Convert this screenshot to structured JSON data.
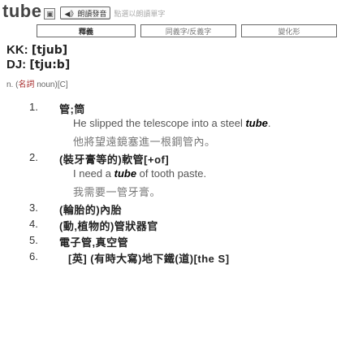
{
  "header": {
    "word": "tube",
    "copy_icon": "▣",
    "speak_button": "◀》朗讀發音",
    "speak_icon": "speaker-icon",
    "note": "點選以朗讀單字"
  },
  "tabs": [
    {
      "label": "釋義",
      "active": true
    },
    {
      "label": "同義字/反義字",
      "active": false
    },
    {
      "label": "變化形",
      "active": false
    }
  ],
  "pronunciation": {
    "kk_label": "KK:",
    "kk_value": "[tjub]",
    "dj_label": "DJ:",
    "dj_value": "[tju:b]"
  },
  "part_of_speech": {
    "abbr": "n.",
    "detail_open": "(",
    "detail_label": "名詞",
    "detail_rest": " noun)[C]"
  },
  "senses": [
    {
      "num": "1.",
      "def": "管;筒",
      "example_pre": "He slipped the telescope into a steel ",
      "example_word": "tube",
      "example_post": ".",
      "translation": "他將望遠鏡塞進一根鋼管內。"
    },
    {
      "num": "2.",
      "def": "(裝牙膏等的)軟管[+of]",
      "example_pre": "I need a ",
      "example_word": "tube",
      "example_post": " of tooth paste.",
      "translation": "我需要一管牙膏。"
    },
    {
      "num": "3.",
      "def": "(輪胎的)內胎"
    },
    {
      "num": "4.",
      "def": "(動,植物的)管狀器官"
    },
    {
      "num": "5.",
      "def": "電子管,真空管"
    },
    {
      "num": "6.",
      "def": "[英] (有時大寫)地下鐵(道)[the S]"
    }
  ]
}
